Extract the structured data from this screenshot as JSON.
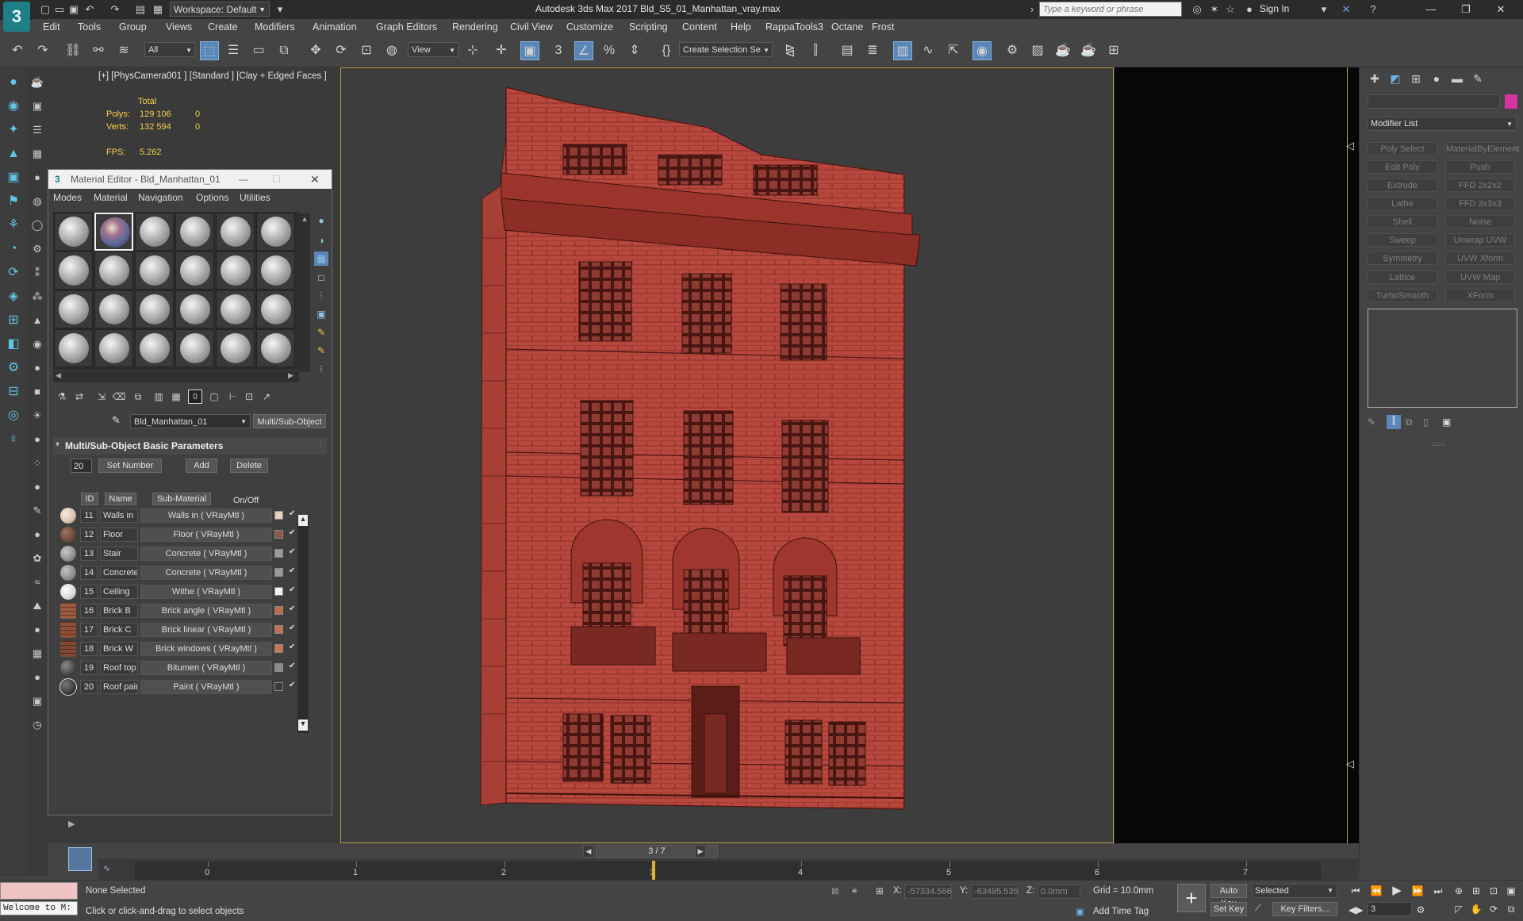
{
  "titlebar": {
    "workspace_label": "Workspace: Default",
    "app_title": "Autodesk 3ds Max 2017      Bld_S5_01_Manhattan_vray.max",
    "search_placeholder": "Type a keyword or phrase",
    "sign_in_label": "Sign In",
    "logo_text": "3"
  },
  "menubar": {
    "items": [
      "Edit",
      "Tools",
      "Group",
      "Views",
      "Create",
      "Modifiers",
      "Animation",
      "Graph Editors",
      "Rendering",
      "Civil View",
      "Customize",
      "Scripting",
      "Content",
      "Help",
      "RappaTools3",
      "Octane",
      "Frost"
    ]
  },
  "toolbar": {
    "selection_filter": "All",
    "ref_coord": "View",
    "named_selection": "Create Selection Se",
    "snap_label": "3",
    "percent_label": "%"
  },
  "viewport": {
    "label": "[+] [PhysCamera001 ] [Standard ] [Clay + Edged Faces ]",
    "stats": {
      "total_header": "Total",
      "polys_label": "Polys:",
      "polys_total": "129 106",
      "polys_sel": "0",
      "verts_label": "Verts:",
      "verts_total": "132 594",
      "verts_sel": "0",
      "fps_label": "FPS:",
      "fps_value": "5.262"
    },
    "building_color": "#b9493f"
  },
  "material_editor": {
    "title": "Material Editor - Bld_Manhattan_01",
    "menus": [
      "Modes",
      "Material",
      "Navigation",
      "Options",
      "Utilities"
    ],
    "material_name": "Bld_Manhattan_01",
    "material_type": "Multi/Sub-Object",
    "rollout_title": "Multi/Sub-Object Basic Parameters",
    "count": "20",
    "set_number_label": "Set Number",
    "add_label": "Add",
    "delete_label": "Delete",
    "headers": {
      "id": "ID",
      "name": "Name",
      "submaterial": "Sub-Material",
      "onoff": "On/Off"
    },
    "rows": [
      {
        "id": "11",
        "name": "Walls in",
        "sub": "Walls in  ( VRayMtl )",
        "ball": "#d6c3ad",
        "swatch": "#e7d3b8"
      },
      {
        "id": "12",
        "name": "Floor",
        "sub": "Floor  ( VRayMtl )",
        "ball": "#6b4a3a",
        "swatch": "#8a5a48"
      },
      {
        "id": "13",
        "name": "Stair",
        "sub": "Concrete  ( VRayMtl )",
        "ball": "#8e8e8e",
        "swatch": "#9a9a9a"
      },
      {
        "id": "14",
        "name": "Concrete",
        "sub": "Concrete  ( VRayMtl )",
        "ball": "#8c8c8c",
        "swatch": "#9a9a9a"
      },
      {
        "id": "15",
        "name": "Ceiling",
        "sub": "Withe  ( VRayMtl )",
        "ball": "#d8d8d8",
        "swatch": "#f2f2f2"
      },
      {
        "id": "16",
        "name": "Brick B",
        "sub": "Brick angle  ( VRayMtl )",
        "ball": "#9a5a40",
        "swatch": "#c06a4a"
      },
      {
        "id": "17",
        "name": "Brick C",
        "sub": "Brick linear  ( VRayMtl )",
        "ball": "#8e5036",
        "swatch": "#c47052"
      },
      {
        "id": "18",
        "name": "Brick W",
        "sub": "Brick windows  ( VRayMtl )",
        "ball": "#7e4a34",
        "swatch": "#c87652"
      },
      {
        "id": "19",
        "name": "Roof top",
        "sub": "Bitumen  ( VRayMtl )",
        "ball": "#4a4a4a",
        "swatch": "#8a8a8a"
      },
      {
        "id": "20",
        "name": "Roof paint",
        "sub": "Paint  ( VRayMtl )",
        "ball": "#3c3c3c",
        "swatch": "#3a3a3a"
      }
    ]
  },
  "command_panel": {
    "modifier_list_label": "Modifier List",
    "object_color": "#d4359f",
    "modifiers": [
      "Poly Select",
      "MaterialByElement",
      "Edit Poly",
      "Push",
      "Extrude",
      "FFD 2x2x2",
      "Lathe",
      "FFD 3x3x3",
      "Shell",
      "Noise",
      "Sweep",
      "Unwrap UVW",
      "Symmetry",
      "UVW Xform",
      "Lattice",
      "UVW Map",
      "TurboSmooth",
      "XForm"
    ]
  },
  "timeline": {
    "frame_display": "3 / 7",
    "ticks": [
      "0",
      "1",
      "2",
      "3",
      "4",
      "5",
      "6",
      "7"
    ]
  },
  "statusbar": {
    "maxscript_text": "Welcome to M:",
    "selection_status": "None Selected",
    "prompt": "Click or click-and-drag to select objects",
    "x_label": "X:",
    "x_value": "-57334.566",
    "y_label": "Y:",
    "y_value": "-63495.535",
    "z_label": "Z:",
    "z_value": "0.0mm",
    "grid": "Grid = 10.0mm",
    "add_time_tag": "Add Time Tag",
    "auto_key": "Auto Key",
    "set_key": "Set Key",
    "key_mode": "Selected",
    "key_filters": "Key Filters...",
    "current_frame": "3"
  }
}
